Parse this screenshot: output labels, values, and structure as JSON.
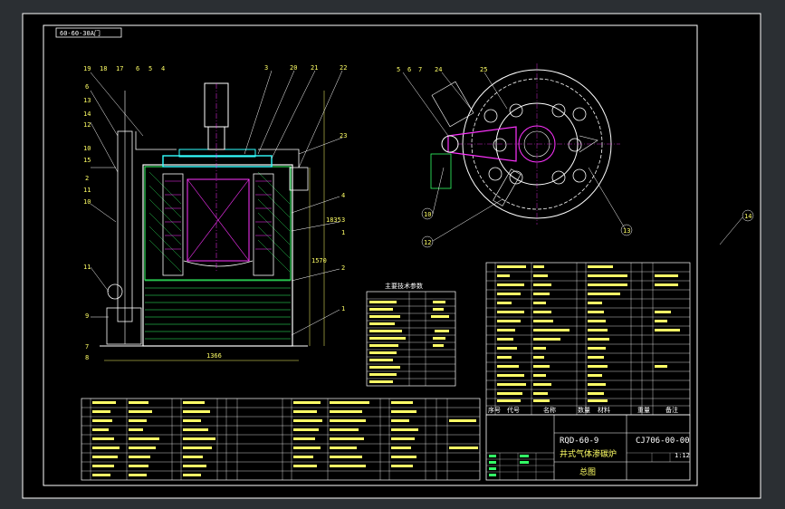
{
  "tab_label": "60-60-30A门",
  "title_block": {
    "model": "RQD-60-9",
    "drawing_no": "CJ706-00-00",
    "name": "井式气体渗碳炉",
    "sheet_title": "总图",
    "col_seq": "序号",
    "col_code": "代号",
    "col_name": "名称",
    "col_qty": "数量",
    "col_material": "材料",
    "col_weight": "重量",
    "col_note": "备注",
    "scale": "1:12"
  },
  "spec_table": {
    "title": "主要技术参数"
  },
  "dimensions": {
    "width": "1366",
    "height_right": "1835",
    "height_inner": "1570"
  },
  "callouts_left": [
    "19",
    "18",
    "17",
    "6",
    "5",
    "4",
    "6",
    "13",
    "14",
    "12",
    "10",
    "15",
    "2",
    "11",
    "10",
    "11",
    "9",
    "7",
    "8"
  ],
  "callouts_top": [
    "3",
    "20",
    "21",
    "22",
    "23",
    "4",
    "3",
    "1",
    "2",
    "1"
  ],
  "callouts_right_view": [
    "5",
    "6",
    "7",
    "24",
    "25",
    "10",
    "12",
    "13",
    "14"
  ],
  "colors": {
    "background": "#2b2f33",
    "sheet": "#000000",
    "line": "#ffffff",
    "accent_yellow": "#ffff66",
    "accent_green": "#33ff66",
    "accent_cyan": "#33ffff",
    "accent_magenta": "#ff33ff"
  }
}
